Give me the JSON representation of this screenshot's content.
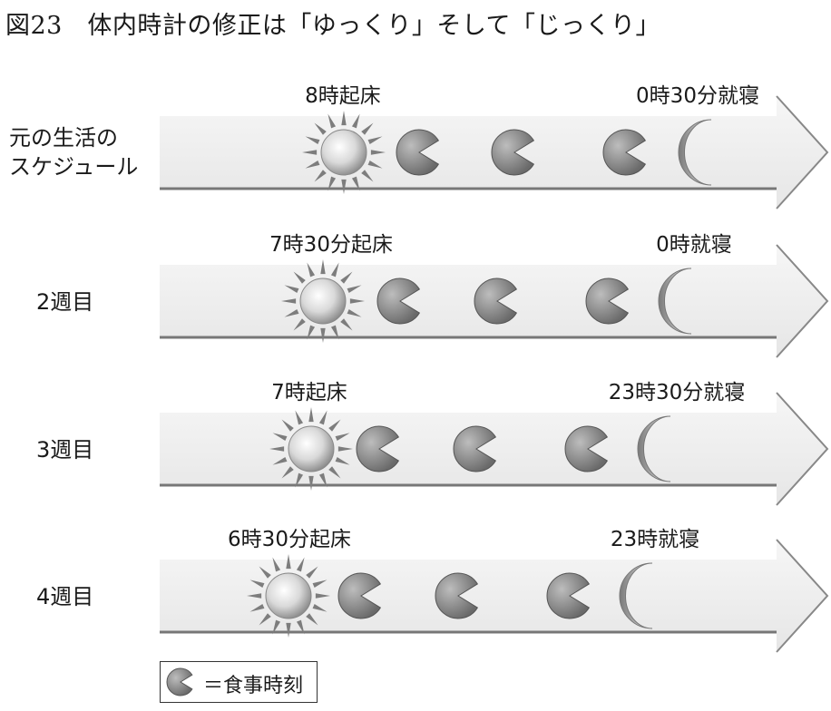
{
  "title": "図23　体内時計の修正は「ゆっくり」そして「じっくり」",
  "rows": [
    {
      "label": "元の生活の\nスケジュール",
      "wake": "8時起床",
      "sleep": "0時30分就寝"
    },
    {
      "label": "2週目",
      "wake": "7時30分起床",
      "sleep": "0時就寝"
    },
    {
      "label": "3週目",
      "wake": "7時起床",
      "sleep": "23時30分就寝"
    },
    {
      "label": "4週目",
      "wake": "6時30分起床",
      "sleep": "23時就寝"
    }
  ],
  "legend": {
    "text": "＝食事時刻",
    "icon": "meal-icon"
  },
  "icons": {
    "wake": "sun-icon",
    "meal": "meal-icon",
    "sleep": "moon-icon"
  },
  "colors": {
    "arrow_fill": "#efefef",
    "arrow_edge": "#888888",
    "icon_fill": "#8c8c8c"
  }
}
